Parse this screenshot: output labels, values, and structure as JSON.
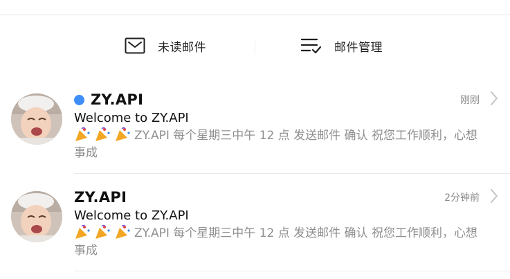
{
  "toolbar": {
    "unread_label": "未读邮件",
    "manage_label": "邮件管理"
  },
  "mails": [
    {
      "sender": "ZY.API",
      "unread": true,
      "time": "刚刚",
      "subject": "Welcome to ZY.API",
      "preview": "ZY.API 每个星期三中午 12 点 发送邮件 确认 祝您工作顺利，心想事成"
    },
    {
      "sender": "ZY.API",
      "unread": false,
      "time": "2分钟前",
      "subject": "Welcome to ZY.API",
      "preview": "ZY.API 每个星期三中午 12 点 发送邮件 确认 祝您工作顺利，心想事成"
    }
  ],
  "colors": {
    "unread_dot": "#3e8ef7",
    "preview_text": "#8f8f8f",
    "time_text": "#8a8a8a"
  },
  "icons": {
    "unread": "envelope-icon",
    "manage": "checklist-icon",
    "row_arrow": "chevron-right-icon",
    "emoji": "party-popper-icon"
  }
}
